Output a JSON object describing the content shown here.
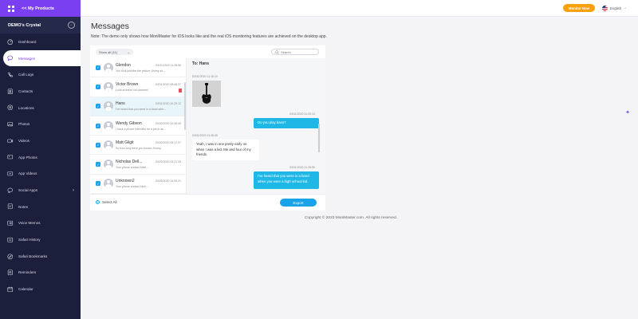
{
  "header": {
    "my_products": "<< My Products",
    "monitor_button": "Monitor Now",
    "language": "English"
  },
  "sidebar": {
    "device_name": "DEMO's Crystal",
    "items": [
      {
        "label": "Dashboard",
        "icon": "dashboard-icon"
      },
      {
        "label": "Messages",
        "icon": "message-icon"
      },
      {
        "label": "Call Logs",
        "icon": "phone-icon"
      },
      {
        "label": "Contacts",
        "icon": "contacts-icon"
      },
      {
        "label": "Locations",
        "icon": "location-icon"
      },
      {
        "label": "Photos",
        "icon": "photo-icon"
      },
      {
        "label": "Videos",
        "icon": "video-icon"
      },
      {
        "label": "App Photos",
        "icon": "app-photo-icon"
      },
      {
        "label": "App Videos",
        "icon": "app-video-icon"
      },
      {
        "label": "Social Apps",
        "icon": "social-icon"
      },
      {
        "label": "Notes",
        "icon": "notes-icon"
      },
      {
        "label": "Voice Memos",
        "icon": "voice-icon"
      },
      {
        "label": "Safari History",
        "icon": "history-icon"
      },
      {
        "label": "Safari Bookmarks",
        "icon": "bookmark-icon"
      },
      {
        "label": "Reminders",
        "icon": "reminder-icon"
      },
      {
        "label": "Calendar",
        "icon": "calendar-icon"
      }
    ]
  },
  "main": {
    "title": "Messages",
    "note": "Note: The demo only shows how MoniMaster for iOS looks like and the real iOS monitoring features are achieved on the desktop app.",
    "filter_label": "Show all (11)",
    "search_placeholder": "Search",
    "contacts": [
      {
        "name": "Glendon",
        "time": "03/31/2020 11:28:56",
        "preview": "You took just like the picture Jimmy sh..."
      },
      {
        "name": "Victor Brown",
        "time": "03/31/2020 08:46:27",
        "preview": "Look at these old pictures!"
      },
      {
        "name": "Hans",
        "time": "03/31/2020 10:29:12",
        "preview": "I've heard that you were in a band whe..."
      },
      {
        "name": "Wendy Gibson",
        "time": "03/30/2020 12:48:49",
        "preview": "I have a phone interview for a job in an..."
      },
      {
        "name": "Matt Gilgit",
        "time": "03/30/2020 09:17:07",
        "preview": "So how long have you known Jimmy..."
      },
      {
        "name": "Nicholas Dell...",
        "time": "03/29/2020 03:21:33",
        "preview": "Your phone contact Matt..."
      },
      {
        "name": "Unknown2",
        "time": "03/28/2020 14:09:21",
        "preview": "Your phone contact Nich..."
      }
    ],
    "chat": {
      "to": "To: Hans",
      "photo_time": "03/31/2020 11:16:10",
      "messages": [
        {
          "dir": "out",
          "time": "03/31/2020 11:20:13",
          "text": "Do you play bass?"
        },
        {
          "dir": "in",
          "time": "03/31/2020 11:28:45",
          "text": "Yeah, I was in one pretty early on when I was a kid. Me and four of my friends."
        },
        {
          "dir": "out",
          "time": "03/31/2020 11:28:59",
          "text": "I've heard that you were in a band when you were a high school kid."
        }
      ]
    },
    "select_all": "Select All",
    "export": "Export",
    "copyright": "Copyright © 2023 MoniMaster.com. All rights reserved."
  },
  "colors": {
    "accent": "#7b3ff2",
    "sidebar_bg": "#1b1f3b",
    "primary_blue": "#1aa3e8",
    "monitor_orange": "#f9a10c"
  }
}
